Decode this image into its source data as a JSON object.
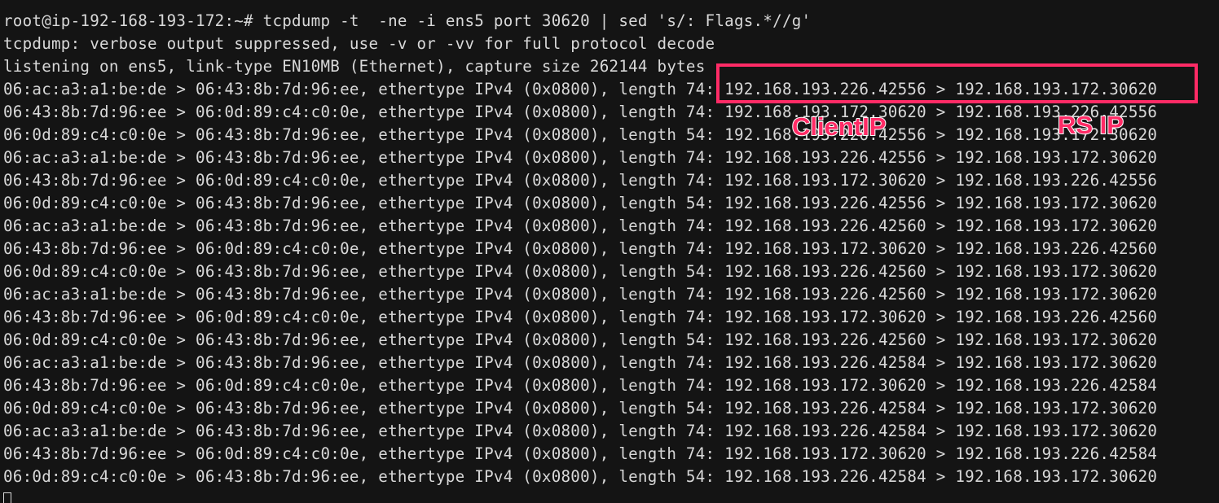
{
  "terminal": {
    "lines": [
      "root@ip-192-168-193-172:~# tcpdump -t  -ne -i ens5 port 30620 | sed 's/: Flags.*//g'",
      "tcpdump: verbose output suppressed, use -v or -vv for full protocol decode",
      "listening on ens5, link-type EN10MB (Ethernet), capture size 262144 bytes",
      "06:ac:a3:a1:be:de > 06:43:8b:7d:96:ee, ethertype IPv4 (0x0800), length 74: 192.168.193.226.42556 > 192.168.193.172.30620",
      "06:43:8b:7d:96:ee > 06:0d:89:c4:c0:0e, ethertype IPv4 (0x0800), length 74: 192.168.193.172.30620 > 192.168.193.226.42556",
      "06:0d:89:c4:c0:0e > 06:43:8b:7d:96:ee, ethertype IPv4 (0x0800), length 54: 192.168.193.226.42556 > 192.168.193.172.30620",
      "06:ac:a3:a1:be:de > 06:43:8b:7d:96:ee, ethertype IPv4 (0x0800), length 74: 192.168.193.226.42556 > 192.168.193.172.30620",
      "06:43:8b:7d:96:ee > 06:0d:89:c4:c0:0e, ethertype IPv4 (0x0800), length 74: 192.168.193.172.30620 > 192.168.193.226.42556",
      "06:0d:89:c4:c0:0e > 06:43:8b:7d:96:ee, ethertype IPv4 (0x0800), length 54: 192.168.193.226.42556 > 192.168.193.172.30620",
      "06:ac:a3:a1:be:de > 06:43:8b:7d:96:ee, ethertype IPv4 (0x0800), length 74: 192.168.193.226.42560 > 192.168.193.172.30620",
      "06:43:8b:7d:96:ee > 06:0d:89:c4:c0:0e, ethertype IPv4 (0x0800), length 74: 192.168.193.172.30620 > 192.168.193.226.42560",
      "06:0d:89:c4:c0:0e > 06:43:8b:7d:96:ee, ethertype IPv4 (0x0800), length 54: 192.168.193.226.42560 > 192.168.193.172.30620",
      "06:ac:a3:a1:be:de > 06:43:8b:7d:96:ee, ethertype IPv4 (0x0800), length 74: 192.168.193.226.42560 > 192.168.193.172.30620",
      "06:43:8b:7d:96:ee > 06:0d:89:c4:c0:0e, ethertype IPv4 (0x0800), length 74: 192.168.193.172.30620 > 192.168.193.226.42560",
      "06:0d:89:c4:c0:0e > 06:43:8b:7d:96:ee, ethertype IPv4 (0x0800), length 54: 192.168.193.226.42560 > 192.168.193.172.30620",
      "06:ac:a3:a1:be:de > 06:43:8b:7d:96:ee, ethertype IPv4 (0x0800), length 74: 192.168.193.226.42584 > 192.168.193.172.30620",
      "06:43:8b:7d:96:ee > 06:0d:89:c4:c0:0e, ethertype IPv4 (0x0800), length 74: 192.168.193.172.30620 > 192.168.193.226.42584",
      "06:0d:89:c4:c0:0e > 06:43:8b:7d:96:ee, ethertype IPv4 (0x0800), length 54: 192.168.193.226.42584 > 192.168.193.172.30620",
      "06:ac:a3:a1:be:de > 06:43:8b:7d:96:ee, ethertype IPv4 (0x0800), length 74: 192.168.193.226.42584 > 192.168.193.172.30620",
      "06:43:8b:7d:96:ee > 06:0d:89:c4:c0:0e, ethertype IPv4 (0x0800), length 74: 192.168.193.172.30620 > 192.168.193.226.42584",
      "06:0d:89:c4:c0:0e > 06:43:8b:7d:96:ee, ethertype IPv4 (0x0800), length 54: 192.168.193.226.42584 > 192.168.193.172.30620"
    ]
  },
  "annotations": {
    "client_label": "ClientIP",
    "rs_label": "RS IP",
    "color": "#ff2b66"
  },
  "colors": {
    "background": "#141414",
    "text": "#d8d8d8"
  }
}
